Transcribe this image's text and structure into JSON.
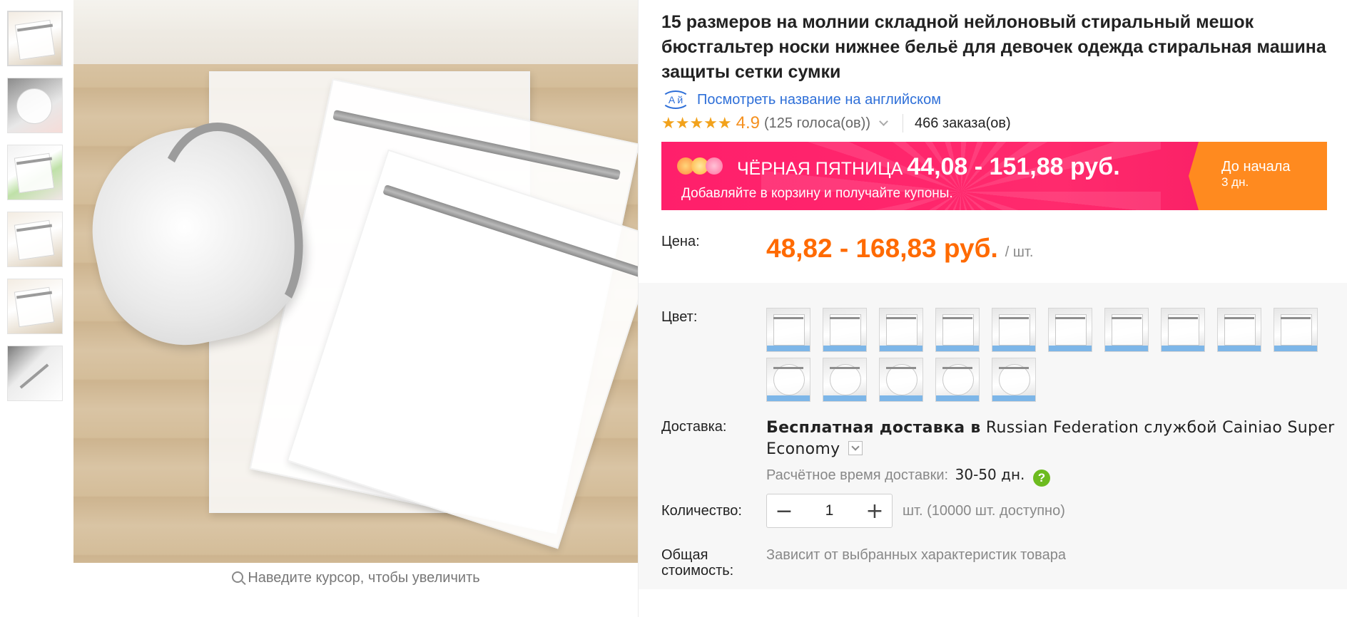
{
  "gallery": {
    "thumbnails": [
      "thumb-1",
      "thumb-2",
      "thumb-3",
      "thumb-4",
      "thumb-5",
      "thumb-6"
    ],
    "zoom_hint": "Наведите курсор, чтобы увеличить"
  },
  "product": {
    "title": "15 размеров на молнии складной нейлоновый стиральный мешок бюстгальтер носки нижнее бельё для девочек одежда стиральная машина защиты сетки сумки",
    "translate_icon_text": "A й",
    "translate_link": "Посмотреть название на английском",
    "rating": {
      "stars": "★★★★★",
      "score": "4.9",
      "votes": "(125 голоса(ов))",
      "orders": "466 заказа(ов)"
    }
  },
  "promo": {
    "label": "ЧЁРНАЯ ПЯТНИЦА",
    "price_range": "44,08 - 151,88 руб.",
    "subtitle": "Добавляйте в корзину и получайте купоны.",
    "countdown_label": "До начала",
    "countdown_value": "3 дн.",
    "colors": {
      "banner": "#ff2a6d",
      "countdown": "#ff8a1f"
    }
  },
  "price": {
    "label": "Цена:",
    "value": "48,82 - 168,83 руб.",
    "unit": "/ шт.",
    "color": "#ff6a00"
  },
  "color_option": {
    "label": "Цвет:",
    "swatch_count": 15
  },
  "shipping": {
    "label": "Доставка:",
    "bold_text": "Бесплатная доставка в",
    "text": "Russian Federation службой Cainiao Super Economy",
    "estimate_label": "Расчётное время доставки:",
    "estimate_value": "30-50 дн.",
    "help_icon": "?"
  },
  "quantity": {
    "label": "Количество:",
    "minus": "−",
    "value": "1",
    "plus": "+",
    "availability": "шт. (10000 шт. доступно)"
  },
  "total": {
    "label_line1": "Общая",
    "label_line2": "стоимость:",
    "value": "Зависит от выбранных характеристик товара"
  }
}
